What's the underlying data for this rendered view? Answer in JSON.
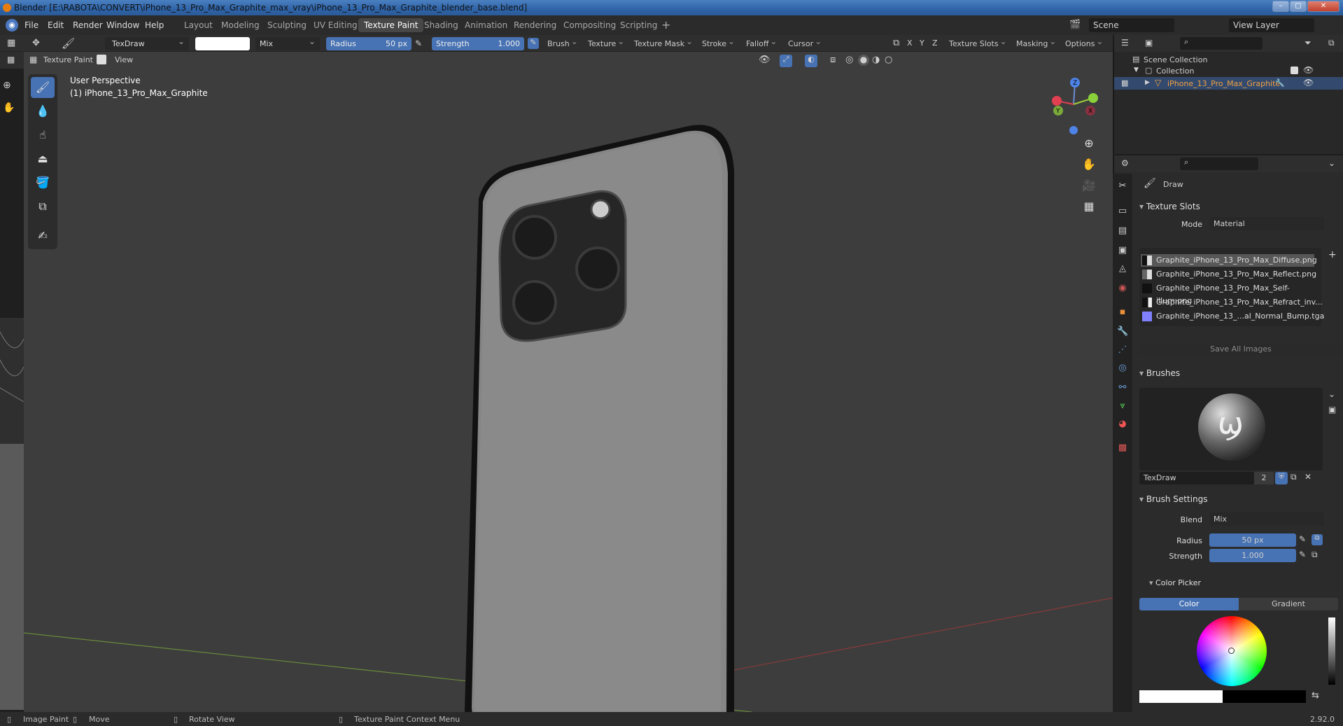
{
  "window": {
    "title": "Blender [E:\\RABOTA\\CONVERT\\iPhone_13_Pro_Max_Graphite_max_vray\\iPhone_13_Pro_Max_Graphite_blender_base.blend]"
  },
  "menu": [
    "File",
    "Edit",
    "Render",
    "Window",
    "Help"
  ],
  "workspaces": [
    "Layout",
    "Modeling",
    "Sculpting",
    "UV Editing",
    "Texture Paint",
    "Shading",
    "Animation",
    "Rendering",
    "Compositing",
    "Scripting"
  ],
  "active_workspace": "Texture Paint",
  "scene": "Scene",
  "view_layer": "View Layer",
  "tool_header": {
    "brush_name": "TexDraw",
    "blend": "Mix",
    "radius_label": "Radius",
    "radius_value": "50 px",
    "strength_label": "Strength",
    "strength_value": "1.000",
    "menus": [
      "Brush",
      "Texture",
      "Texture Mask",
      "Stroke",
      "Falloff",
      "Cursor"
    ],
    "axes": [
      "X",
      "Y",
      "Z"
    ],
    "right_menus": [
      "Texture Slots",
      "Masking",
      "Options"
    ]
  },
  "viewport_header": {
    "mode": "Texture Paint",
    "view": "View"
  },
  "viewport": {
    "line1": "User Perspective",
    "line2": "(1) iPhone_13_Pro_Max_Graphite"
  },
  "gizmo": {
    "z": "Z",
    "y": "Y",
    "x": "X"
  },
  "outliner": {
    "root": "Scene Collection",
    "collection": "Collection",
    "object": "iPhone_13_Pro_Max_Graphite"
  },
  "properties": {
    "tool": "Draw",
    "texture_slots_title": "Texture Slots",
    "mode_label": "Mode",
    "mode_value": "Material",
    "slots": [
      "Graphite_iPhone_13_Pro_Max_Diffuse.png",
      "Graphite_iPhone_13_Pro_Max_Reflect.png",
      "Graphite_iPhone_13_Pro_Max_Self-illum.png",
      "Graphite_iPhone_13_Pro_Max_Refract_inv...",
      "Graphite_iPhone_13_...al_Normal_Bump.tga"
    ],
    "save_all": "Save All Images",
    "brushes_title": "Brushes",
    "brush_name": "TexDraw",
    "brush_users": "2",
    "brush_settings_title": "Brush Settings",
    "blend_label": "Blend",
    "blend_value": "Mix",
    "radius_label": "Radius",
    "radius_value": "50 px",
    "strength_label": "Strength",
    "strength_value": "1.000",
    "color_picker_title": "Color Picker",
    "color_tab": "Color",
    "gradient_tab": "Gradient"
  },
  "status": {
    "image_paint": "Image Paint",
    "move": "Move",
    "rotate": "Rotate View",
    "context": "Texture Paint Context Menu",
    "version": "2.92.0"
  }
}
